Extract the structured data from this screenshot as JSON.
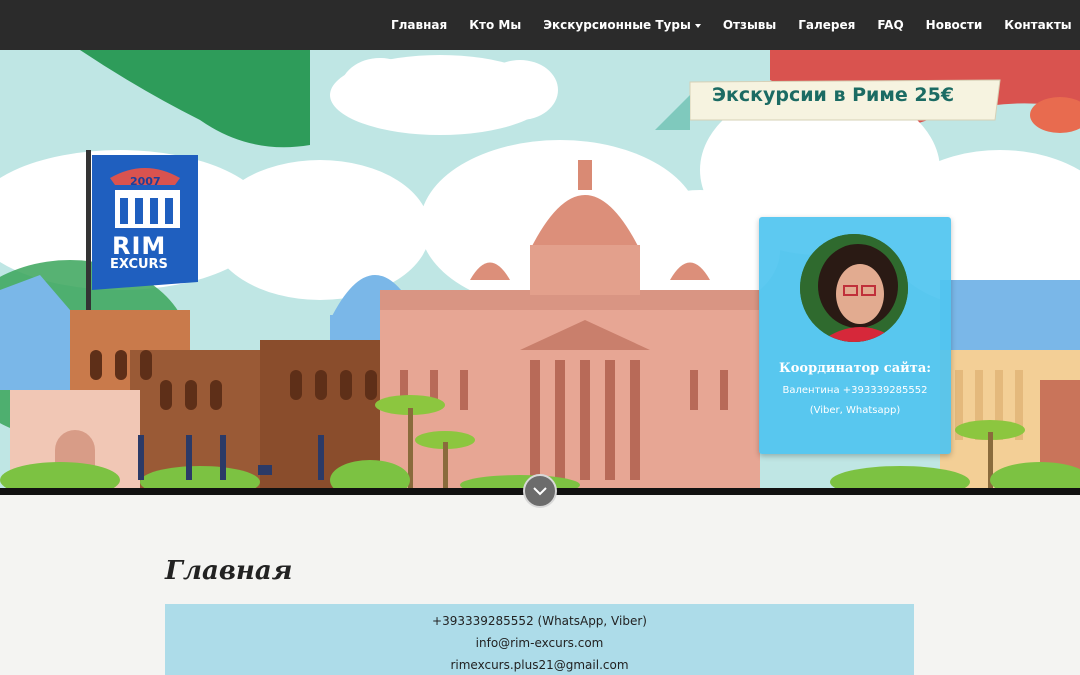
{
  "nav": {
    "items": [
      {
        "label": "Главная"
      },
      {
        "label": "Кто Мы"
      },
      {
        "label": "Экскурсионные Туры",
        "dropdown": true
      },
      {
        "label": "Отзывы"
      },
      {
        "label": "Галерея"
      },
      {
        "label": "FAQ"
      },
      {
        "label": "Новости"
      },
      {
        "label": "Контакты"
      }
    ]
  },
  "hero": {
    "banner": "Экскурсии в Риме 25€",
    "logo": {
      "year": "2007",
      "line1": "RIM",
      "line2": "EXCURS"
    },
    "scroll_icon": "chevron-down-icon"
  },
  "coordinator": {
    "title": "Координатор сайта:",
    "line1": "Валентина +393339285552",
    "line2": "(Viber, Whatsapp)"
  },
  "main": {
    "title": "Главная",
    "contacts": [
      "+393339285552 (WhatsApp, Viber)",
      "info@rim-excurs.com",
      "rimexcurs.plus21@gmail.com"
    ]
  },
  "colors": {
    "nav_bg": "#2b2b2b",
    "card_bg": "#4fc4f0",
    "contact_bg": "#addce9",
    "banner_text": "#1b6b63"
  }
}
